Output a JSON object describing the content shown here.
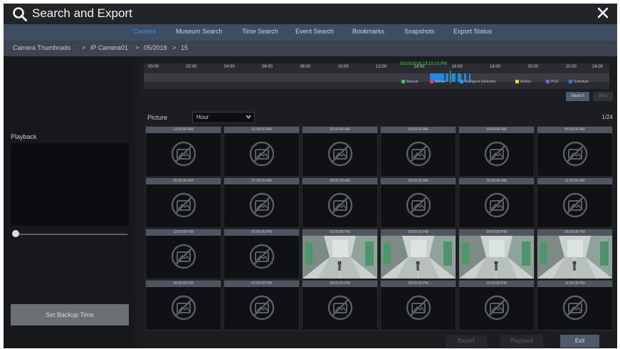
{
  "window": {
    "title": "Search and Export",
    "search_icon": "search-icon",
    "close_icon": "close-icon"
  },
  "tabs": [
    {
      "label": "Camera",
      "active": true
    },
    {
      "label": "Museum Search",
      "active": false
    },
    {
      "label": "Time Search",
      "active": false
    },
    {
      "label": "Event Search",
      "active": false
    },
    {
      "label": "Bookmarks",
      "active": false
    },
    {
      "label": "Snapshots",
      "active": false
    },
    {
      "label": "Export Status",
      "active": false
    }
  ],
  "breadcrumb": {
    "items": [
      "Camera Thumbnails",
      "IP Camera01",
      "05/2018",
      "15"
    ],
    "separator": ">"
  },
  "left_panel": {
    "playback_label": "Playback",
    "slider_value": 0,
    "backup_button": "Set Backup Time"
  },
  "timeline": {
    "hour_labels": [
      "00:00",
      "02:00",
      "04:00",
      "06:00",
      "08:00",
      "10:00",
      "12:00",
      "14:00",
      "16:00",
      "18:00",
      "20:00",
      "22:00",
      "24:00"
    ],
    "current_time": "05/15/2018 13:15:13 PM",
    "legend": [
      {
        "label": "Manual",
        "color": "#38c95a"
      },
      {
        "label": "Sensor",
        "color": "#e0413c"
      },
      {
        "label": "Intelligent Detection",
        "color": "#2f96e8"
      },
      {
        "label": "Motion",
        "color": "#e5d93a"
      },
      {
        "label": "POS",
        "color": "#8c56d8"
      },
      {
        "label": "Schedule",
        "color": "#2f78e8"
      }
    ],
    "search_button": "Search",
    "stop_button": "Stop"
  },
  "picture": {
    "label": "Picture",
    "selected": "Hour",
    "page_count": "1/24"
  },
  "thumbnails": [
    {
      "time": "12:00:00 AM",
      "has_image": false
    },
    {
      "time": "01:00:00 AM",
      "has_image": false
    },
    {
      "time": "02:00:00 AM",
      "has_image": false
    },
    {
      "time": "03:00:00 AM",
      "has_image": false
    },
    {
      "time": "04:00:00 AM",
      "has_image": false
    },
    {
      "time": "05:00:00 AM",
      "has_image": false
    },
    {
      "time": "06:00:00 AM",
      "has_image": false
    },
    {
      "time": "07:00:00 AM",
      "has_image": false
    },
    {
      "time": "08:00:00 AM",
      "has_image": false
    },
    {
      "time": "09:00:00 AM",
      "has_image": false
    },
    {
      "time": "10:00:00 AM",
      "has_image": false
    },
    {
      "time": "11:00:00 AM",
      "has_image": false
    },
    {
      "time": "12:00:00 PM",
      "has_image": false
    },
    {
      "time": "01:00:00 PM",
      "has_image": false
    },
    {
      "time": "02:00:00 PM",
      "has_image": true
    },
    {
      "time": "03:00:00 PM",
      "has_image": true
    },
    {
      "time": "04:00:00 PM",
      "has_image": true
    },
    {
      "time": "05:00:00 PM",
      "has_image": true
    },
    {
      "time": "06:00:00 PM",
      "has_image": false
    },
    {
      "time": "07:00:00 PM",
      "has_image": false
    },
    {
      "time": "08:00:00 PM",
      "has_image": false
    },
    {
      "time": "09:00:00 PM",
      "has_image": false
    },
    {
      "time": "10:00:00 PM",
      "has_image": false
    },
    {
      "time": "11:00:00 PM",
      "has_image": false
    }
  ],
  "buttons": {
    "export": "Export",
    "playback": "Playback",
    "exit": "Exit"
  },
  "colors": {
    "accent": "#2f96e8",
    "record": "#1f8ae6",
    "current": "#3fd64b"
  }
}
